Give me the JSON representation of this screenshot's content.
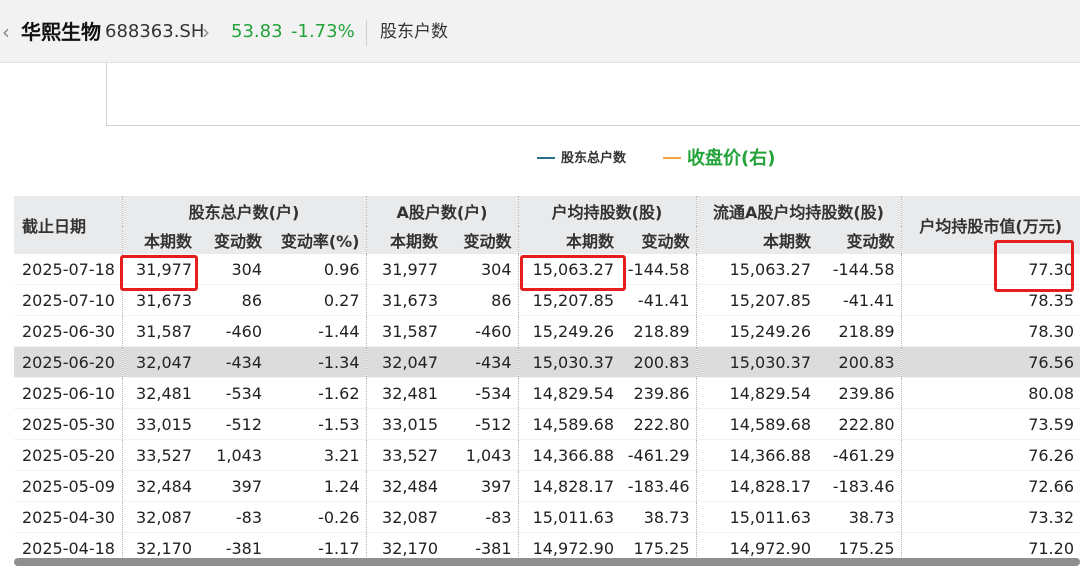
{
  "header": {
    "back_icon": "‹",
    "stock_name": "华熙生物",
    "stock_code": "688363.SH",
    "forward_icon": "›",
    "price": "53.83",
    "change_pct": "-1.73%",
    "page_title": "股东户数",
    "colors": {
      "down": "#23a33a"
    }
  },
  "legend": {
    "items": [
      {
        "label": "股东总户数",
        "color": "#2b6f8f"
      },
      {
        "label": "收盘价(右)",
        "color": "#f2a53a"
      }
    ]
  },
  "table": {
    "group_headers": {
      "date": "截止日期",
      "total_holders": "股东总户数(户)",
      "a_holders": "A股户数(户)",
      "avg_shares": "户均持股数(股)",
      "float_avg_shares": "流通A股户均持股数(股)",
      "avg_value": "户均持股市值(万元)"
    },
    "sub_headers": {
      "current": "本期数",
      "change": "变动数",
      "change_rate": "变动率(%)"
    },
    "rows": [
      [
        "2025-07-18",
        "31,977",
        "304",
        "0.96",
        "31,977",
        "304",
        "15,063.27",
        "-144.58",
        "15,063.27",
        "-144.58",
        "77.30"
      ],
      [
        "2025-07-10",
        "31,673",
        "86",
        "0.27",
        "31,673",
        "86",
        "15,207.85",
        "-41.41",
        "15,207.85",
        "-41.41",
        "78.35"
      ],
      [
        "2025-06-30",
        "31,587",
        "-460",
        "-1.44",
        "31,587",
        "-460",
        "15,249.26",
        "218.89",
        "15,249.26",
        "218.89",
        "78.30"
      ],
      [
        "2025-06-20",
        "32,047",
        "-434",
        "-1.34",
        "32,047",
        "-434",
        "15,030.37",
        "200.83",
        "15,030.37",
        "200.83",
        "76.56"
      ],
      [
        "2025-06-10",
        "32,481",
        "-534",
        "-1.62",
        "32,481",
        "-534",
        "14,829.54",
        "239.86",
        "14,829.54",
        "239.86",
        "80.08"
      ],
      [
        "2025-05-30",
        "33,015",
        "-512",
        "-1.53",
        "33,015",
        "-512",
        "14,589.68",
        "222.80",
        "14,589.68",
        "222.80",
        "73.59"
      ],
      [
        "2025-05-20",
        "33,527",
        "1,043",
        "3.21",
        "33,527",
        "1,043",
        "14,366.88",
        "-461.29",
        "14,366.88",
        "-461.29",
        "76.26"
      ],
      [
        "2025-05-09",
        "32,484",
        "397",
        "1.24",
        "32,484",
        "397",
        "14,828.17",
        "-183.46",
        "14,828.17",
        "-183.46",
        "72.66"
      ],
      [
        "2025-04-30",
        "32,087",
        "-83",
        "-0.26",
        "32,087",
        "-83",
        "15,011.63",
        "38.73",
        "15,011.63",
        "38.73",
        "73.32"
      ],
      [
        "2025-04-18",
        "32,170",
        "-381",
        "-1.17",
        "32,170",
        "-381",
        "14,972.90",
        "175.25",
        "14,972.90",
        "175.25",
        "71.20"
      ]
    ],
    "highlighted_row_index": 3,
    "annotation_color": "#e41e1e"
  }
}
